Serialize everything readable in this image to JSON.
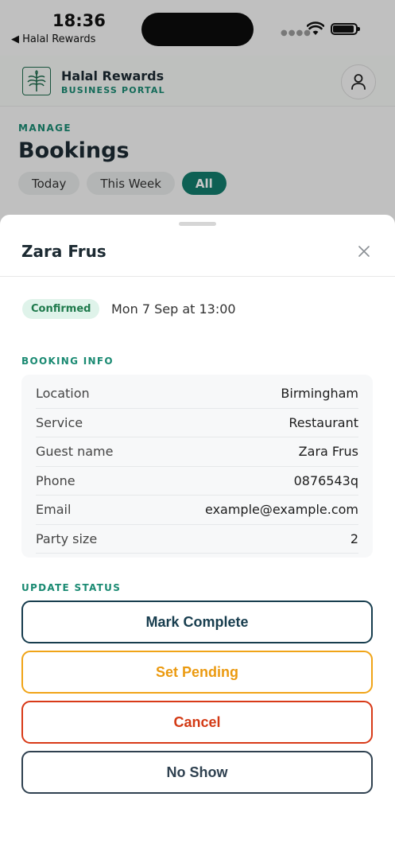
{
  "status_bar": {
    "time": "18:36",
    "back_app": "◀ Halal Rewards"
  },
  "header": {
    "brand_name": "Halal Rewards",
    "brand_sub": "BUSINESS PORTAL"
  },
  "page": {
    "section": "MANAGE",
    "title": "Bookings",
    "filters": [
      {
        "label": "Today",
        "active": false
      },
      {
        "label": "This Week",
        "active": false
      },
      {
        "label": "All",
        "active": true
      }
    ]
  },
  "sheet": {
    "title": "Zara Frus",
    "status": "Confirmed",
    "datetime": "Mon 7 Sep at 13:00",
    "booking_info_label": "BOOKING INFO",
    "booking_info": [
      {
        "key": "Location",
        "value": "Birmingham"
      },
      {
        "key": "Service",
        "value": "Restaurant"
      },
      {
        "key": "Guest name",
        "value": "Zara Frus"
      },
      {
        "key": "Phone",
        "value": "0876543q"
      },
      {
        "key": "Email",
        "value": "example@example.com"
      },
      {
        "key": "Party size",
        "value": "2"
      }
    ],
    "update_status_label": "UPDATE STATUS",
    "actions": {
      "complete": "Mark Complete",
      "pending": "Set Pending",
      "cancel": "Cancel",
      "noshow": "No Show"
    }
  },
  "colors": {
    "brand_teal": "#137c6c",
    "confirmed_bg": "#dff3ea",
    "pending": "#f0a417",
    "cancel": "#d83a18",
    "navy": "#173d4e"
  },
  "icons": {
    "logo": "palm-leaf-icon",
    "profile": "user-icon",
    "close": "close-icon",
    "wifi": "wifi-icon",
    "battery": "battery-icon"
  }
}
